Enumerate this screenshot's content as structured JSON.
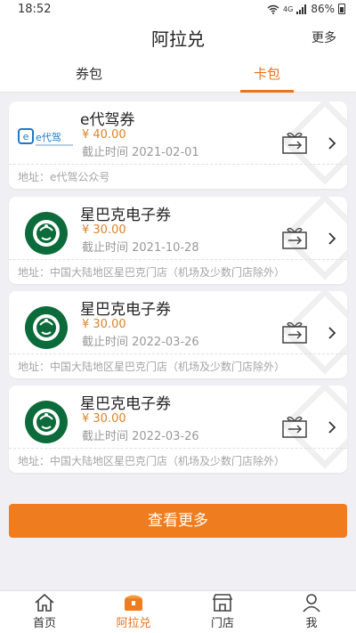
{
  "status_bar": {
    "time": "18:52",
    "network": "4G",
    "battery": "86%"
  },
  "header": {
    "title": "阿拉兑",
    "more": "更多"
  },
  "tabs": [
    {
      "label": "券包"
    },
    {
      "label": "卡包",
      "active": true
    }
  ],
  "cards": [
    {
      "logo": "edaijia-logo",
      "name": "e代驾券",
      "price": "¥ 40.00",
      "expire": "截止时间 2021-02-01",
      "address": "地址：e代驾公众号"
    },
    {
      "logo": "starbucks-logo",
      "name": "星巴克电子券",
      "price": "¥ 30.00",
      "expire": "截止时间 2021-10-28",
      "address": "地址：中国大陆地区星巴克门店（机场及少数门店除外）"
    },
    {
      "logo": "starbucks-logo",
      "name": "星巴克电子券",
      "price": "¥ 30.00",
      "expire": "截止时间 2022-03-26",
      "address": "地址：中国大陆地区星巴克门店（机场及少数门店除外）"
    },
    {
      "logo": "starbucks-logo",
      "name": "星巴克电子券",
      "price": "¥ 30.00",
      "expire": "截止时间 2022-03-26",
      "address": "地址：中国大陆地区星巴克门店（机场及少数门店除外）"
    }
  ],
  "edaijia_logo_text": "e代驾",
  "more_button": "查看更多",
  "bottom_nav": [
    {
      "label": "首页",
      "icon": "home-icon"
    },
    {
      "label": "阿拉兑",
      "icon": "treasure-icon",
      "active": true
    },
    {
      "label": "门店",
      "icon": "store-icon"
    },
    {
      "label": "我",
      "icon": "user-icon"
    }
  ],
  "colors": {
    "accent": "#e8741c",
    "button": "#ef7d1f",
    "price": "#d9852b",
    "background": "#efeff4"
  }
}
